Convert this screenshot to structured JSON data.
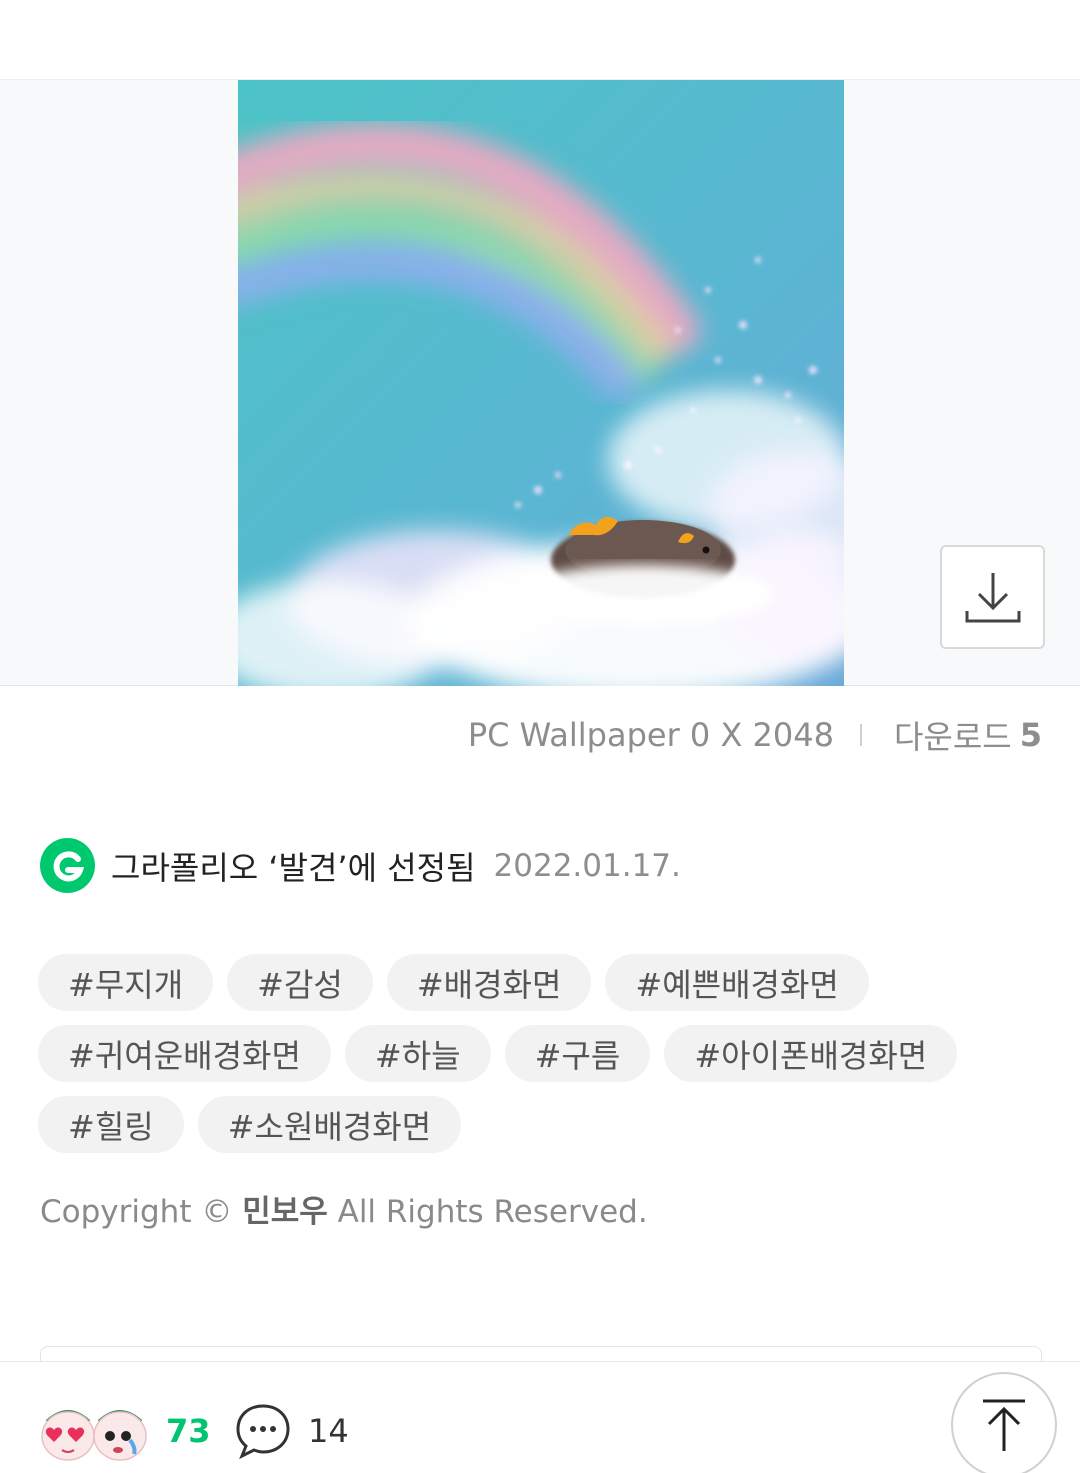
{
  "artwork": {
    "colors": {
      "sky": "#5bbfc9",
      "cloud": "#f4f4fb",
      "creature": "#5e4b45",
      "bow": "#f2a21c"
    }
  },
  "meta": {
    "wallpaper_label": "PC Wallpaper 0 X 2048",
    "download_label": "다운로드",
    "download_count": "5"
  },
  "selection": {
    "text": "그라폴리오 ‘발견’에 선정됨",
    "date": "2022.01.17.",
    "logo_color": "#00c86f"
  },
  "tags": [
    [
      "#무지개",
      "#감성",
      "#배경화면",
      "#예쁜배경화면"
    ],
    [
      "#귀여운배경화면",
      "#하늘",
      "#구름",
      "#아이폰배경화면"
    ],
    [
      "#힐링",
      "#소원배경화면"
    ]
  ],
  "copyright": {
    "prefix": "Copyright ©",
    "owner": "민보우",
    "suffix": "All Rights Reserved."
  },
  "bottom_bar": {
    "reactions_count": "73",
    "comments_count": "14",
    "accent_color": "#00c471"
  }
}
